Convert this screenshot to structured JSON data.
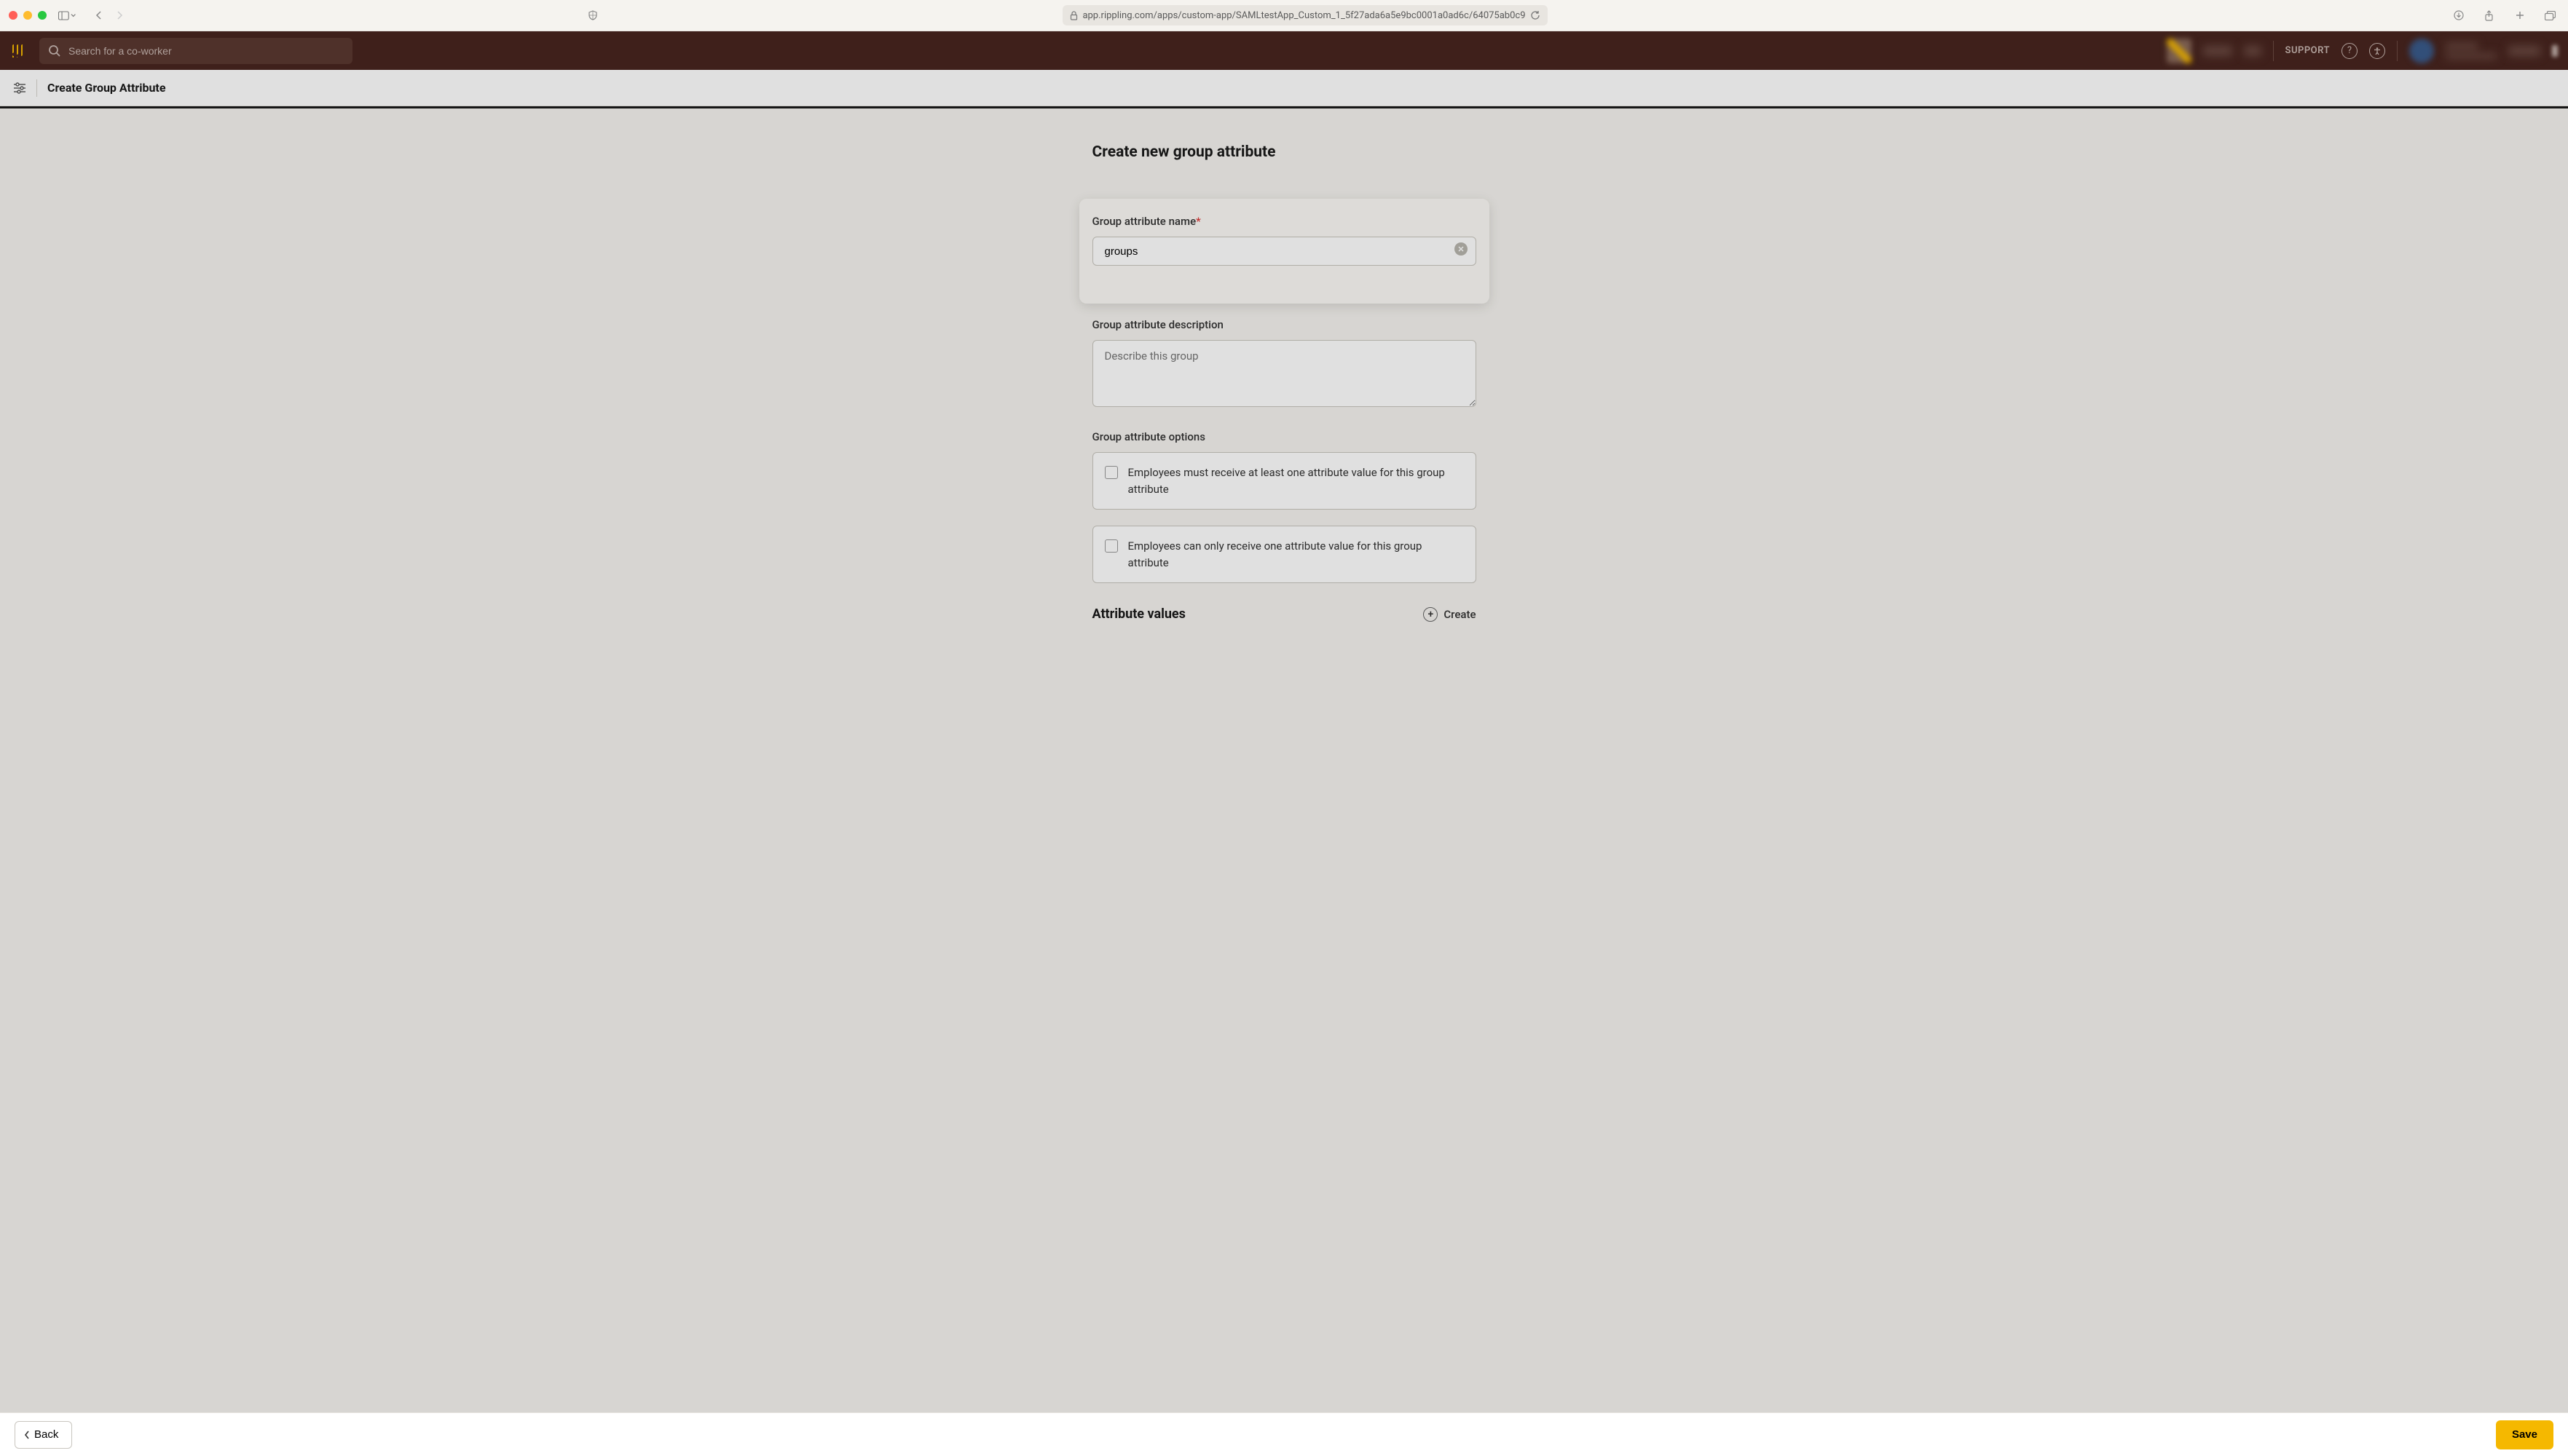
{
  "browser": {
    "url": "app.rippling.com/apps/custom-app/SAMLtestApp_Custom_1_5f27ada6a5e9bc0001a0ad6c/64075ab0c9"
  },
  "header": {
    "search_placeholder": "Search for a co-worker",
    "support_label": "SUPPORT"
  },
  "subheader": {
    "title": "Create Group Attribute"
  },
  "page": {
    "title": "Create new group attribute"
  },
  "form": {
    "name_label": "Group attribute name",
    "name_value": "groups",
    "desc_label": "Group attribute description",
    "desc_placeholder": "Describe this group",
    "options_label": "Group attribute options",
    "option1_label": "Employees must receive at least one attribute value for this group attribute",
    "option2_label": "Employees can only receive one attribute value for this group attribute"
  },
  "attribute_values": {
    "title": "Attribute values",
    "create_label": "Create"
  },
  "footer": {
    "back_label": "Back",
    "save_label": "Save"
  }
}
